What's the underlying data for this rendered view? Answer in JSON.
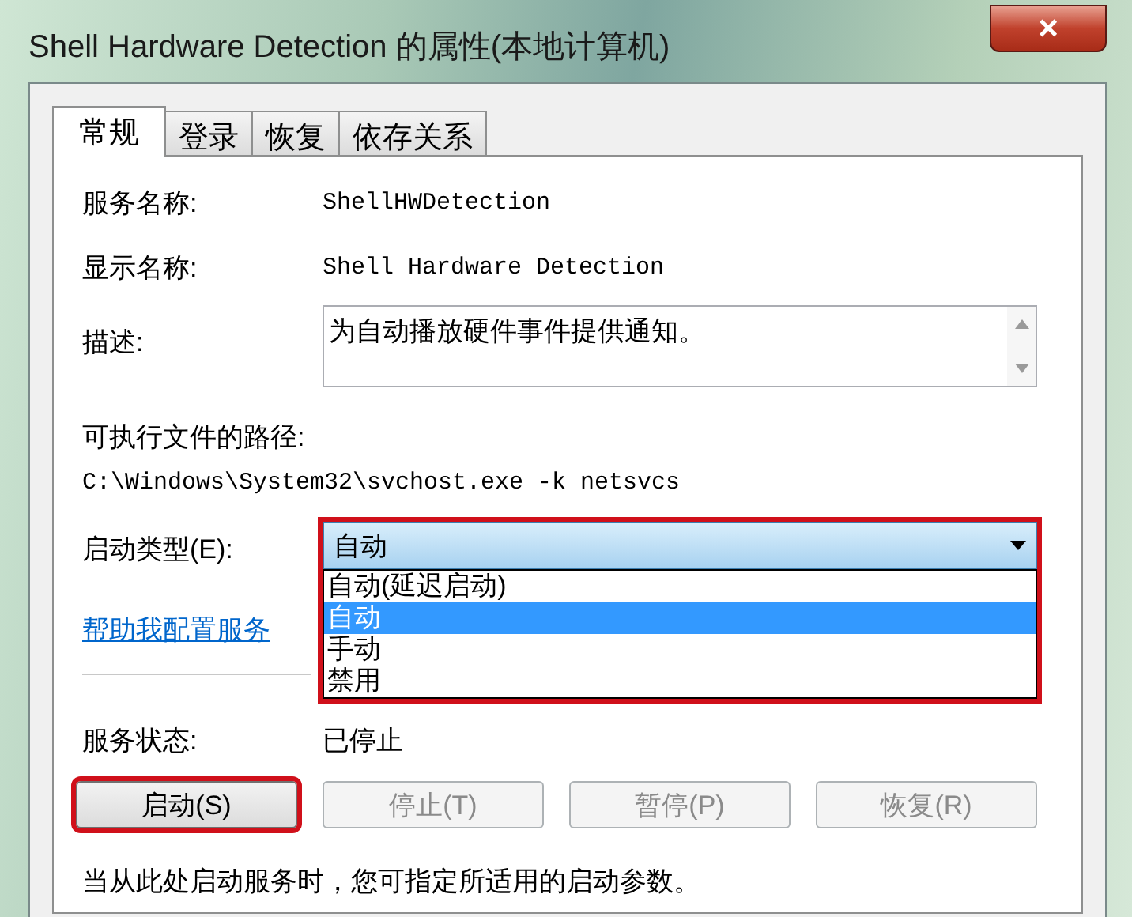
{
  "window": {
    "title": "Shell Hardware Detection 的属性(本地计算机)",
    "close": "×"
  },
  "tabs": [
    {
      "label": "常规",
      "selected": true
    },
    {
      "label": "登录",
      "selected": false
    },
    {
      "label": "恢复",
      "selected": false
    },
    {
      "label": "依存关系",
      "selected": false
    }
  ],
  "service_name": {
    "label": "服务名称:",
    "value": "ShellHWDetection"
  },
  "display_name": {
    "label": "显示名称:",
    "value": "Shell Hardware Detection"
  },
  "description": {
    "label": "描述:",
    "value": "为自动播放硬件事件提供通知。"
  },
  "path": {
    "label": "可执行文件的路径:",
    "value": "C:\\Windows\\System32\\svchost.exe -k netsvcs"
  },
  "startup_type": {
    "label": "启动类型(E):",
    "value": "自动",
    "expanded": true,
    "highlighted": true,
    "options": [
      {
        "label": "自动(延迟启动)",
        "selected": false
      },
      {
        "label": "自动",
        "selected": true
      },
      {
        "label": "手动",
        "selected": false
      },
      {
        "label": "禁用",
        "selected": false
      }
    ]
  },
  "help_link": "帮助我配置服务",
  "status": {
    "label": "服务状态:",
    "value": "已停止"
  },
  "buttons": [
    {
      "label": "启动(S)",
      "disabled": false,
      "highlighted": true
    },
    {
      "label": "停止(T)",
      "disabled": true,
      "highlighted": false
    },
    {
      "label": "暂停(P)",
      "disabled": true,
      "highlighted": false
    },
    {
      "label": "恢复(R)",
      "disabled": true,
      "highlighted": false
    }
  ],
  "note": "当从此处启动服务时，您可指定所适用的启动参数。"
}
